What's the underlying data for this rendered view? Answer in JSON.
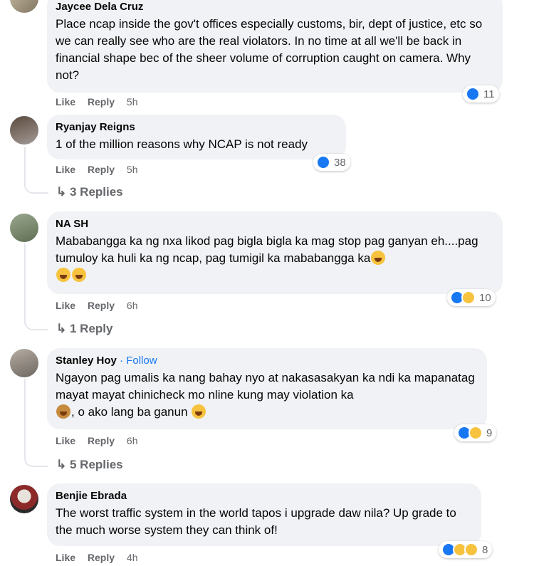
{
  "comments": [
    {
      "name": "Jaycee Dela Cruz",
      "text": "Place ncap inside the gov't offices especially customs, bir, dept of justice, etc so we can really see who are the real violators. In no time at all we'll be back in financial shape bec of the sheer volume of corruption caught on camera. Why not?",
      "like": "Like",
      "reply": "Reply",
      "time": "5h",
      "reaction_count": "11"
    },
    {
      "name": "Ryanjay Reigns",
      "text": "1 of the million reasons why NCAP is not ready",
      "like": "Like",
      "reply": "Reply",
      "time": "5h",
      "reaction_count": "38",
      "replies": "3 Replies"
    },
    {
      "name": "NA SH",
      "text": "Mababangga ka ng nxa likod pag bigla bigla ka mag stop pag ganyan eh....pag tumuloy ka huli ka ng ncap, pag tumigil ka mababangga ka",
      "like": "Like",
      "reply": "Reply",
      "time": "6h",
      "reaction_count": "10",
      "replies": "1 Reply"
    },
    {
      "name": "Stanley Hoy",
      "follow": "· Follow",
      "text": "Ngayon pag umalis ka nang bahay nyo at nakasasakyan ka ndi ka mapanatag mayat mayat chinicheck mo nline kung may violation ka",
      "text_tail": ", o ako lang ba ganun",
      "like": "Like",
      "reply": "Reply",
      "time": "6h",
      "reaction_count": "9",
      "replies": "5 Replies"
    },
    {
      "name": "Benjie Ebrada",
      "text": "The worst traffic system in the world tapos i upgrade daw nila? Up grade to the much worse system they can think of!",
      "like": "Like",
      "reply": "Reply",
      "time": "4h",
      "reaction_count": "8"
    }
  ],
  "icons": {
    "reply_arrow": "reply-arrow-icon",
    "like": "like-reaction-icon",
    "haha": "haha-reaction-icon",
    "wow": "wow-reaction-icon"
  },
  "colors": {
    "bubble": "#f0f2f5",
    "meta": "#65676b",
    "link": "#1877f2"
  }
}
